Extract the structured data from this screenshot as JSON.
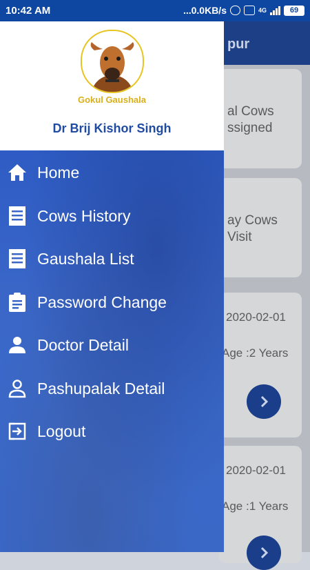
{
  "status_bar": {
    "time": "10:42 AM",
    "network_speed": "...0.0KB/s",
    "network_type": "4G",
    "battery": "69"
  },
  "background": {
    "title_fragment": "pur",
    "cards": [
      {
        "line1": "al Cows",
        "line2": "ssigned"
      },
      {
        "line1": "ay Cows",
        "line2": "Visit"
      },
      {
        "date": "2020-02-01",
        "age": "Age :2 Years"
      },
      {
        "date": "2020-02-01",
        "age": "Age :1 Years"
      }
    ]
  },
  "drawer": {
    "logo_text": "Gokul Gaushala",
    "doctor_name": "Dr Brij Kishor Singh",
    "menu": [
      {
        "label": "Home",
        "icon": "home-icon"
      },
      {
        "label": "Cows History",
        "icon": "list-icon"
      },
      {
        "label": "Gaushala List",
        "icon": "list-icon"
      },
      {
        "label": "Password Change",
        "icon": "clipboard-icon"
      },
      {
        "label": "Doctor Detail",
        "icon": "person-icon"
      },
      {
        "label": "Pashupalak Detail",
        "icon": "person-outline-icon"
      },
      {
        "label": "Logout",
        "icon": "logout-icon"
      }
    ]
  },
  "colors": {
    "status_bar": "#0d47a1",
    "drawer_menu": "#3a66c8",
    "logo_ring": "#e8c420",
    "doctor_name": "#1f4ba0"
  }
}
